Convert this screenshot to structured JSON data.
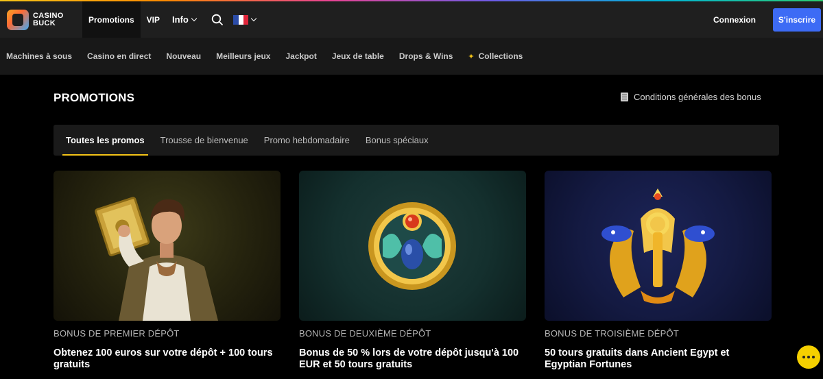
{
  "brand": {
    "line1": "CASINO",
    "line2": "BUCK"
  },
  "topnav": {
    "promotions": "Promotions",
    "vip": "VIP",
    "info": "Info"
  },
  "auth": {
    "login": "Connexion",
    "signup": "S'inscrire"
  },
  "categories": [
    "Machines à sous",
    "Casino en direct",
    "Nouveau",
    "Meilleurs jeux",
    "Jackpot",
    "Jeux de table",
    "Drops & Wins",
    "Collections"
  ],
  "page": {
    "title": "PROMOTIONS",
    "terms": "Conditions générales des bonus"
  },
  "tabs": [
    {
      "label": "Toutes les promos",
      "active": true
    },
    {
      "label": "Trousse de bienvenue",
      "active": false
    },
    {
      "label": "Promo hebdomadaire",
      "active": false
    },
    {
      "label": "Bonus spéciaux",
      "active": false
    }
  ],
  "cards": [
    {
      "kicker": "BONUS DE PREMIER DÉPÔT",
      "title": "Obtenez 100 euros sur votre dépôt + 100 tours gratuits"
    },
    {
      "kicker": "BONUS DE DEUXIÈME DÉPÔT",
      "title": "Bonus de 50 % lors de votre dépôt jusqu'à 100 EUR et 50 tours gratuits"
    },
    {
      "kicker": "BONUS DE TROISIÈME DÉPÔT",
      "title": "50 tours gratuits dans Ancient Egypt et Egyptian Fortunes"
    }
  ],
  "colors": {
    "accent": "#f5c518",
    "signup": "#3d6bf5",
    "header": "#1f1f1f",
    "catbar": "#181818"
  }
}
